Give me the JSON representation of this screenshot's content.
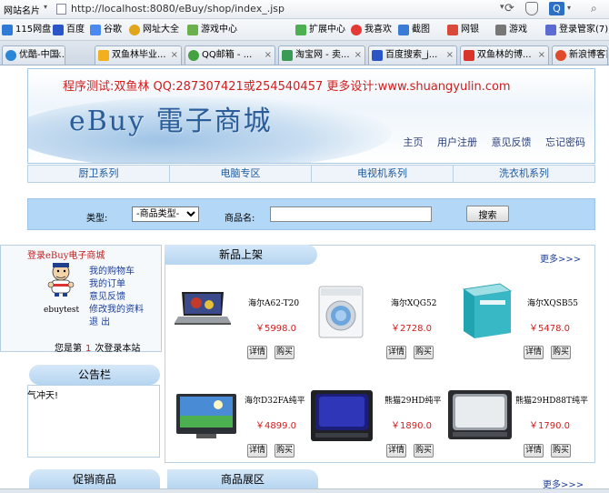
{
  "browser": {
    "site_name": "网站名片",
    "url": "http://localhost:8080/eBuy/shop/index_.jsp",
    "bookmarks": [
      "115网盘",
      "百度",
      "谷歌",
      "网址大全",
      "游戏中心",
      "扩展中心",
      "我喜欢",
      "截图",
      "网银",
      "游戏",
      "登录管家(7)"
    ],
    "tabs": [
      "优酷-中国...",
      "双鱼林毕业...",
      "QQ邮箱 - ...",
      "淘宝网 - 卖...",
      "百度搜索_j...",
      "双鱼林的博...",
      "新浪博客首"
    ]
  },
  "banner": {
    "contact": "程序测试:双鱼林 QQ:287307421或254540457 更多设计:www.shuangyulin.com",
    "logo": "eBuy 電子商城"
  },
  "topnav": [
    "主页",
    "用户注册",
    "意见反馈",
    "忘记密码"
  ],
  "categories": [
    "厨卫系列",
    "电脑专区",
    "电视机系列",
    "洗衣机系列"
  ],
  "search": {
    "type_label": "类型:",
    "type_value": "-商品类型-",
    "name_label": "商品名:",
    "button": "搜索"
  },
  "user_panel": {
    "title": "登录eBuy电子商城",
    "links": [
      "我的购物车",
      "我的订单",
      "意见反馈",
      "修改我的资料",
      "退 出"
    ],
    "username": "ebuytest",
    "visits_prefix": "您是第",
    "visits_count": "1",
    "visits_suffix": "次登录本站"
  },
  "notice": {
    "title": "公告栏",
    "text": "气冲天!"
  },
  "new_products": {
    "title": "新品上架",
    "more": "更多>>>",
    "detail_label": "详情",
    "buy_label": "购买",
    "items": [
      {
        "name": "海尔A62-T20",
        "price": "￥5998.0"
      },
      {
        "name": "海尔XQG52",
        "price": "￥2728.0"
      },
      {
        "name": "海尔XQSB55",
        "price": "￥5478.0"
      },
      {
        "name": "海尔D32FA纯平",
        "price": "￥4899.0"
      },
      {
        "name": "熊猫29HD纯平",
        "price": "￥1890.0"
      },
      {
        "name": "熊猫29HD88T纯平",
        "price": "￥1790.0"
      }
    ]
  },
  "bottom": {
    "promo": "促销商品",
    "showcase": "商品展区",
    "more": "更多>>>"
  },
  "colors": {
    "accent": "#b3d7f6",
    "link": "#1d3f9a",
    "price": "#d21d1d"
  }
}
